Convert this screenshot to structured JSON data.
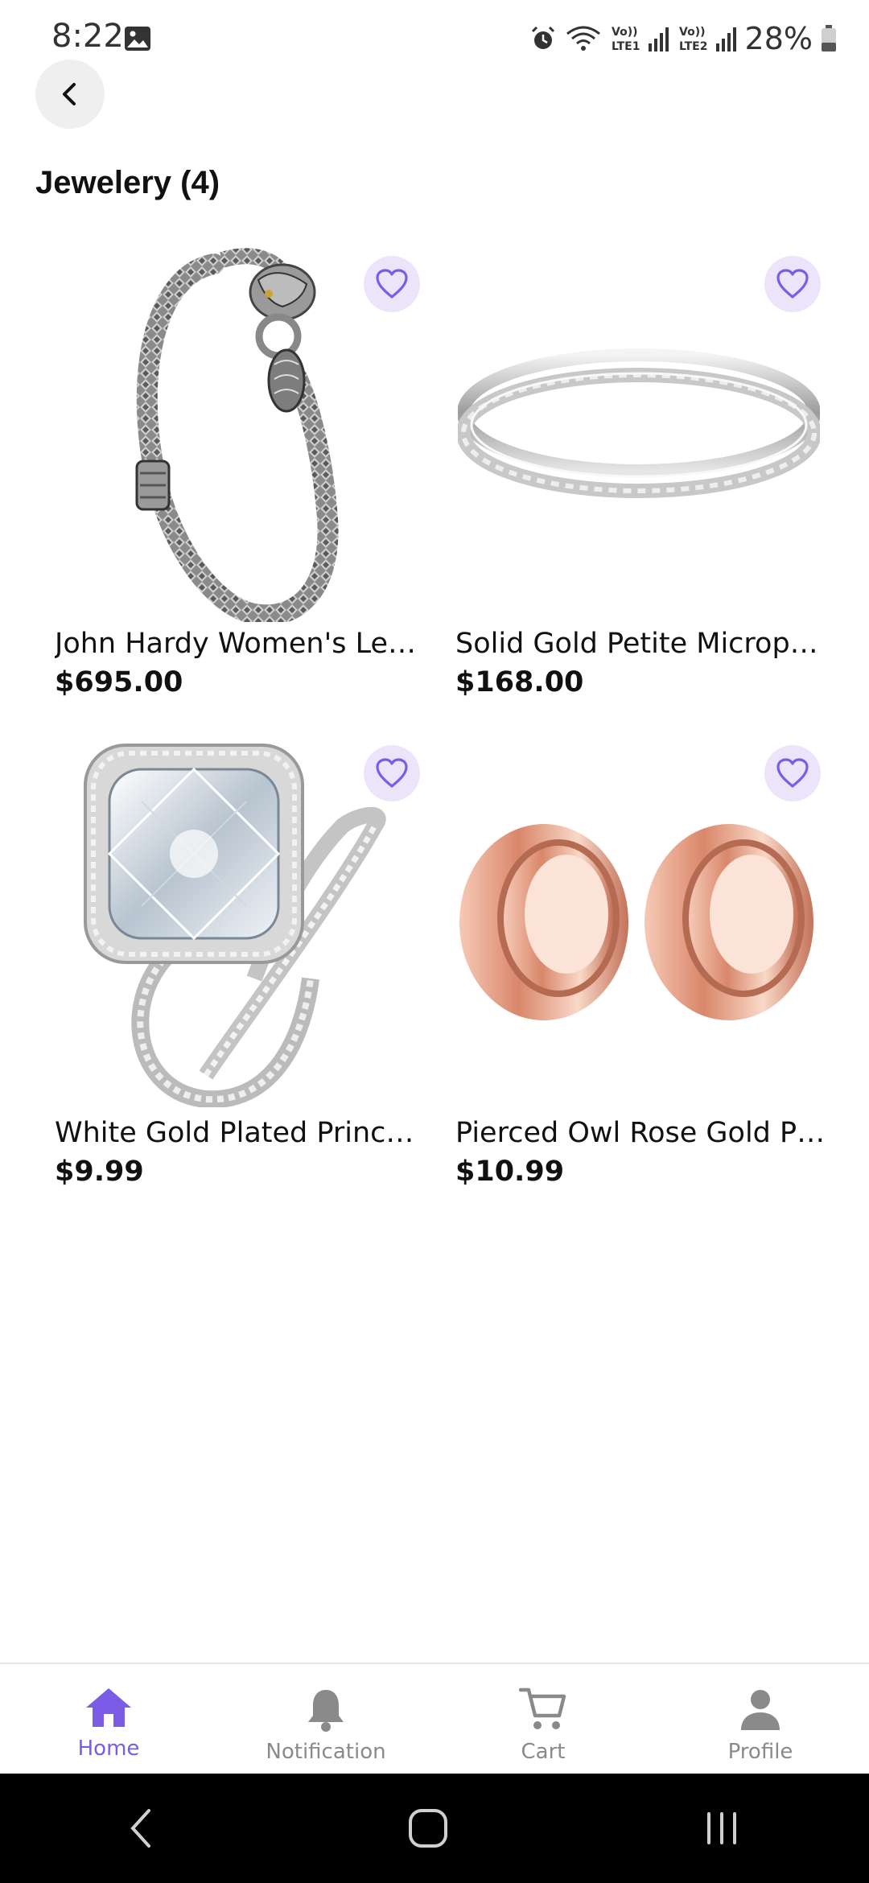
{
  "status_bar": {
    "time": "8:22",
    "battery": "28%",
    "icons": [
      "image-icon",
      "alarm-icon",
      "wifi-icon",
      "volte1-signal-icon",
      "volte2-signal-icon",
      "battery-icon"
    ]
  },
  "header": {
    "back_icon": "chevron-left-icon",
    "title": "Jewelery (4)"
  },
  "products": [
    {
      "name": "John Hardy Women's Lege...",
      "price": "$695.00",
      "image": "silver-chain-bracelet",
      "favorite_icon": "heart-outline-icon"
    },
    {
      "name": "Solid Gold Petite Micropave",
      "price": "$168.00",
      "image": "micropave-ring",
      "favorite_icon": "heart-outline-icon"
    },
    {
      "name": "White Gold Plated Princess",
      "price": "$9.99",
      "image": "princess-cut-ring-set",
      "favorite_icon": "heart-outline-icon"
    },
    {
      "name": "Pierced Owl Rose Gold Pla...",
      "price": "$10.99",
      "image": "rose-gold-tunnel-plugs",
      "favorite_icon": "heart-outline-icon"
    }
  ],
  "bottom_nav": {
    "items": [
      {
        "label": "Home",
        "icon": "home-icon",
        "active": true
      },
      {
        "label": "Notification",
        "icon": "bell-icon",
        "active": false
      },
      {
        "label": "Cart",
        "icon": "cart-icon",
        "active": false
      },
      {
        "label": "Profile",
        "icon": "person-icon",
        "active": false
      }
    ]
  },
  "colors": {
    "accent": "#7b5ce6",
    "favorite_bg": "#ece4fb",
    "inactive": "#8a8a8a"
  }
}
